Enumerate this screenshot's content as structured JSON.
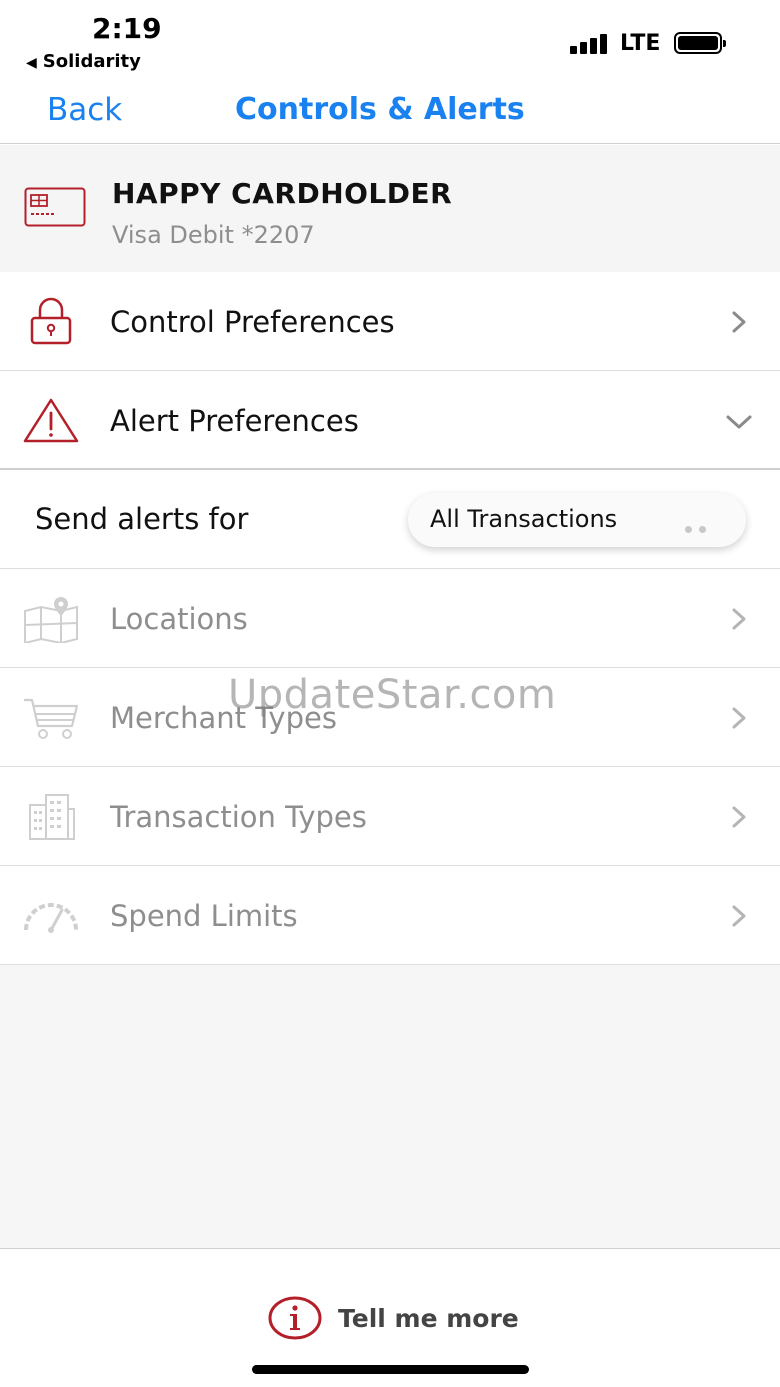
{
  "status_bar": {
    "time": "2:19",
    "carrier": "Solidarity",
    "network": "LTE"
  },
  "nav": {
    "back_label": "Back",
    "title": "Controls & Alerts",
    "accent_color": "#1a82f0"
  },
  "card": {
    "holder": "HAPPY CARDHOLDER",
    "subtitle": "Visa Debit *2207",
    "icon": "credit-card-icon",
    "icon_color": "#b4202a"
  },
  "rows": {
    "control": {
      "label": "Control Preferences",
      "icon": "lock-icon"
    },
    "alert": {
      "label": "Alert Preferences",
      "icon": "warning-triangle-icon"
    }
  },
  "send_alerts": {
    "label": "Send alerts for",
    "selected": "All Transactions"
  },
  "alert_items": [
    {
      "label": "Locations",
      "icon": "map-pin-icon"
    },
    {
      "label": "Merchant Types",
      "icon": "shopping-cart-icon"
    },
    {
      "label": "Transaction Types",
      "icon": "building-icon"
    },
    {
      "label": "Spend Limits",
      "icon": "speedometer-icon"
    }
  ],
  "watermark": "UpdateStar.com",
  "footer": {
    "tell_label": "Tell me more",
    "icon": "info-icon"
  }
}
